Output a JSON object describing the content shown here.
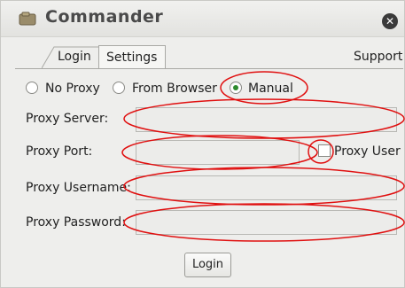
{
  "window": {
    "title": "Commander",
    "app_icon": "commander-app-icon",
    "close_icon": "close-icon"
  },
  "tabs": {
    "login": "Login",
    "settings": "Settings",
    "support": "Support"
  },
  "proxy_mode": {
    "options": [
      "No Proxy",
      "From Browser",
      "Manual"
    ],
    "selected": "Manual"
  },
  "form": {
    "proxy_server_label": "Proxy Server:",
    "proxy_server_value": "",
    "proxy_port_label": "Proxy Port:",
    "proxy_port_value": "",
    "proxy_user_label": "Proxy User",
    "proxy_username_label": "Proxy Username:",
    "proxy_username_value": "",
    "proxy_password_label": "Proxy Password:",
    "proxy_password_value": ""
  },
  "buttons": {
    "login": "Login"
  },
  "annotation_color": "#e01010"
}
